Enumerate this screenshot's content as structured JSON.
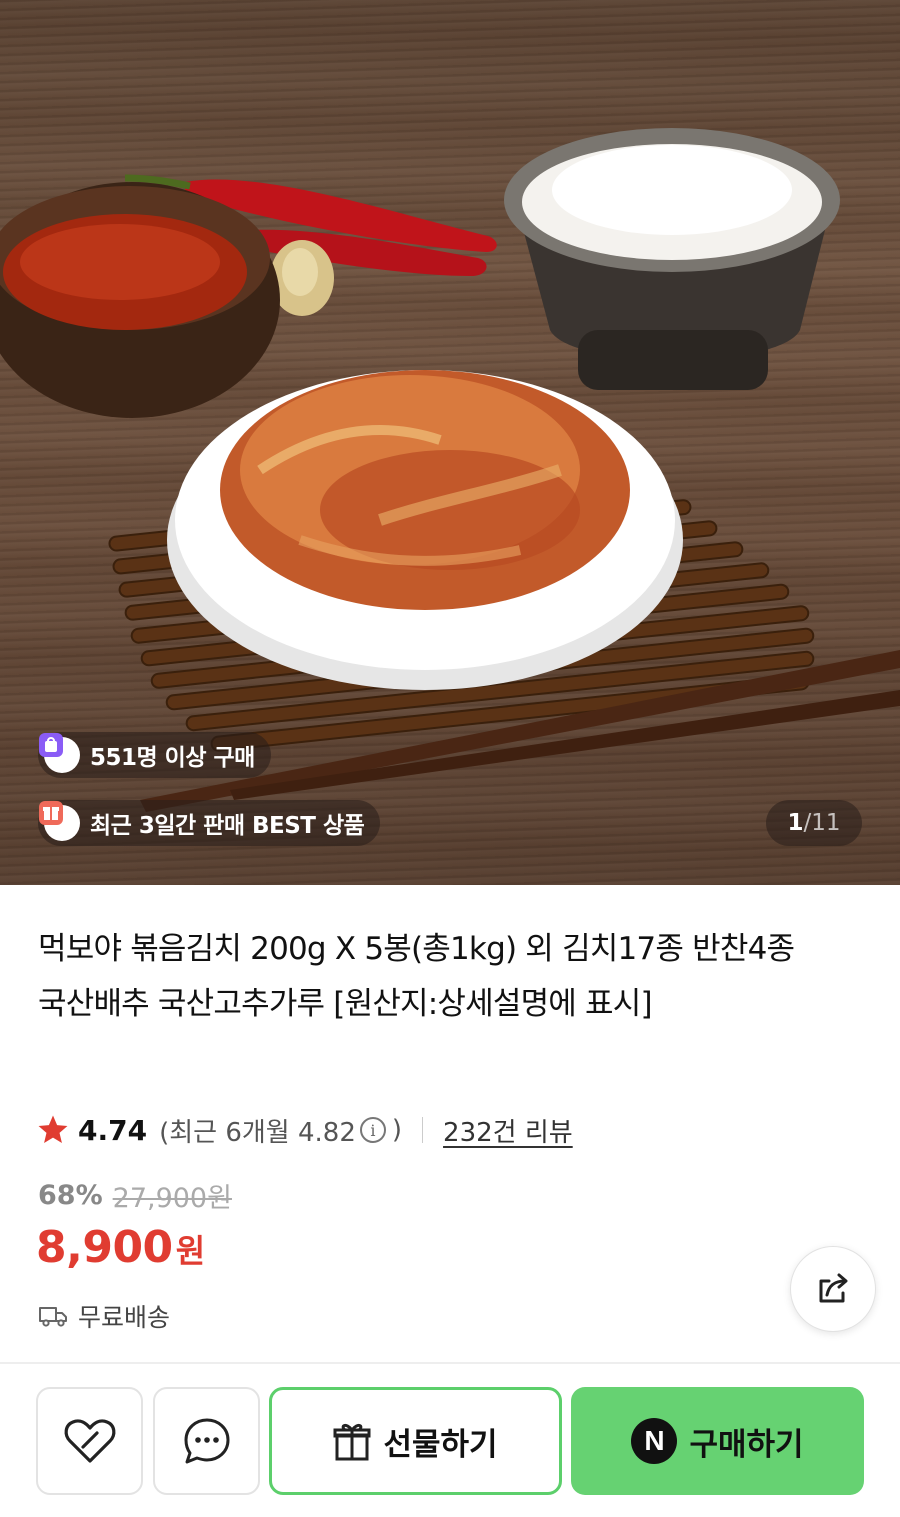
{
  "hero": {
    "image_alt": "볶음김치",
    "buyers_badge": "551명 이상 구매",
    "best_badge": "최근 3일간 판매 BEST 상품",
    "counter_current": "1",
    "counter_separator": "/",
    "counter_total": "11"
  },
  "product": {
    "title": "먹보야 볶음김치 200g X 5봉(총1kg) 외 김치17종 반찬4종 국산배추 국산고추가루 [원산지:상세설명에 표시]",
    "rating": "4.74",
    "recent_rating_open": "(최근 6개월 4.82",
    "info_glyph": "i",
    "recent_rating_close": ")",
    "review_count": "232건 리뷰",
    "discount_rate": "68%",
    "original_price": "27,900원",
    "sale_price": "8,900",
    "currency": "원",
    "shipping": "무료배송"
  },
  "actions": {
    "gift_label": "선물하기",
    "buy_label": "구매하기",
    "buy_logo": "N"
  },
  "colors": {
    "price_red": "#e03c31",
    "buy_green": "#66d272",
    "gift_border": "#5ccf6b",
    "star_red": "#e03c31"
  },
  "icons": [
    "bag-icon",
    "gift-box-icon",
    "star-icon",
    "info-icon",
    "truck-icon",
    "share-icon",
    "heart-icon",
    "chat-icon",
    "gift-icon",
    "naver-n-icon"
  ]
}
